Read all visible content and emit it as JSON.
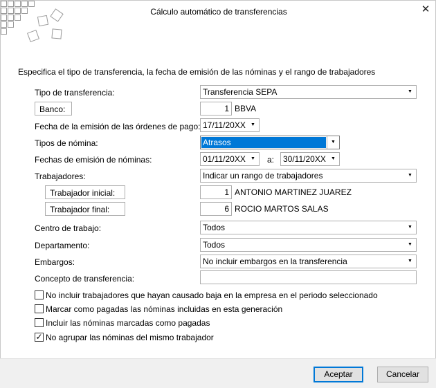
{
  "window": {
    "title": "Cálculo automático de transferencias",
    "close_glyph": "✕"
  },
  "instructions": "Especifica el tipo de transferencia, la fecha de emisión de las nóminas y el rango de trabajadores",
  "tipo_transferencia": {
    "label": "Tipo de transferencia:",
    "value": "Transferencia SEPA"
  },
  "banco": {
    "button_label": "Banco:",
    "code": "1",
    "name": "BBVA"
  },
  "fecha_ordenes": {
    "label": "Fecha de la emisión de las órdenes de pago:",
    "value": "17/11/20XX"
  },
  "tipos_nomina": {
    "label": "Tipos de nómina:",
    "value": "Atrasos"
  },
  "fechas_nominas": {
    "label": "Fechas de emisión de nóminas:",
    "from": "01/11/20XX",
    "sep": "a:",
    "to": "30/11/20XX"
  },
  "trabajadores": {
    "label": "Trabajadores:",
    "value": "Indicar un rango de trabajadores",
    "inicial": {
      "button_label": "Trabajador inicial:",
      "code": "1",
      "name": "ANTONIO MARTINEZ JUAREZ"
    },
    "final": {
      "button_label": "Trabajador final:",
      "code": "6",
      "name": "ROCIO MARTOS SALAS"
    }
  },
  "centro": {
    "label": "Centro de trabajo:",
    "value": "Todos"
  },
  "departamento": {
    "label": "Departamento:",
    "value": "Todos"
  },
  "embargos": {
    "label": "Embargos:",
    "value": "No incluir embargos en la transferencia"
  },
  "concepto": {
    "label": "Concepto de transferencia:",
    "value": ""
  },
  "options": [
    {
      "label": "No incluir trabajadores que hayan causado baja en la empresa en el periodo seleccionado",
      "checked": false
    },
    {
      "label": "Marcar como pagadas las nóminas incluidas en esta generación",
      "checked": false
    },
    {
      "label": "Incluir las nóminas marcadas como pagadas",
      "checked": false
    },
    {
      "label": "No agrupar las nóminas del mismo trabajador",
      "checked": true
    }
  ],
  "buttons": {
    "accept": "Aceptar",
    "cancel": "Cancelar"
  },
  "icons": {
    "dropdown": "chevron-down-icon",
    "check": "check-icon",
    "logo": "tiles-logo-icon"
  },
  "colors": {
    "selection": "#0078d7",
    "footer": "#f0f0f0"
  }
}
